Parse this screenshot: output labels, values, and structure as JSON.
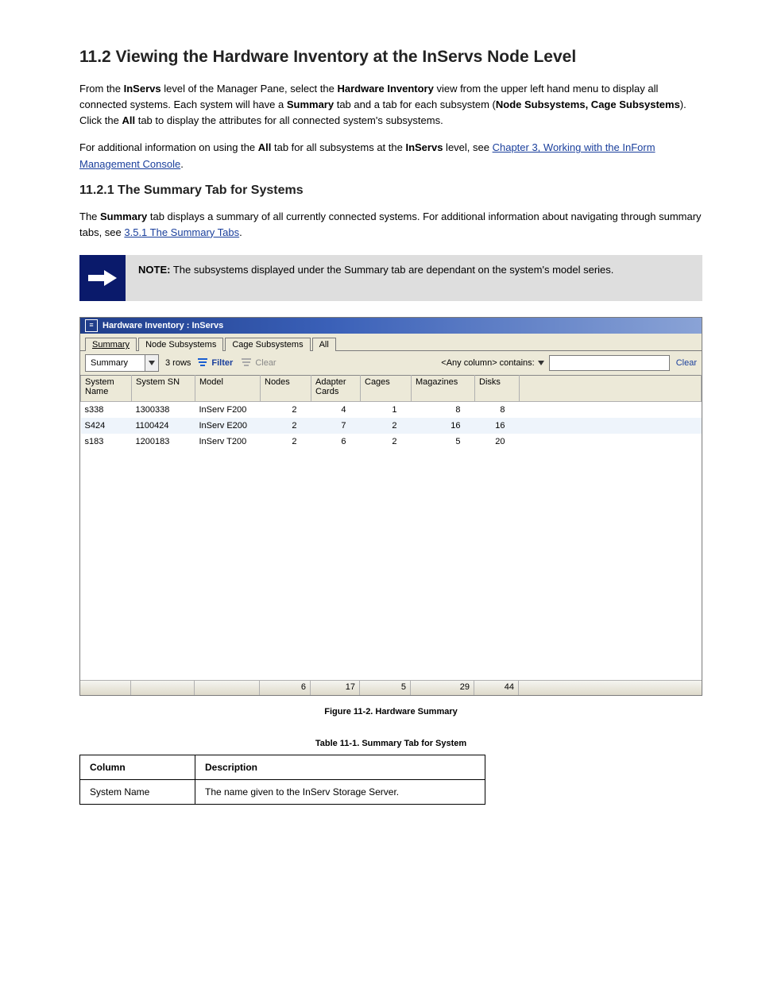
{
  "headings": {
    "page_title": "11.2 Viewing the Hardware Inventory at the InServs Node Level",
    "sub1": "11.2.1 The Summary Tab for Systems",
    "caption": "Figure 11-2.  Hardware Summary",
    "caption2": "Table 11-1.  Summary Tab for System"
  },
  "paragraphs": {
    "p1_a": "From the ",
    "p1_b": " level of the Manager Pane, select the ",
    "p1_c": " view from the upper left hand menu to display all connected systems. Each system will have a ",
    "p1_d": " tab and a tab for each subsystem (",
    "p1_e": "). Click the ",
    "p1_f": " tab to display the attributes for all connected system's subsystems.",
    "p1_inservs": "InServs",
    "p1_hwinv": "Hardware Inventory",
    "p1_summary": "Summary",
    "p1_subs": "Node Subsystems, Cage Subsystems",
    "p1_all": "All",
    "p2_a": "For additional information on using the ",
    "p2_b": " tab for all subsystems at the ",
    "p2_c": " level, see ",
    "p2_link": "Chapter 3, Working with the InForm Management Console",
    "p2_d": ".",
    "p2_all": "All",
    "p2_inservs": "InServs",
    "p3_a": "The ",
    "p3_b": " tab displays a summary of all currently connected systems. For additional information about navigating through summary tabs, see ",
    "p3_link": "3.5.1 The Summary Tabs",
    "p3_c": ".",
    "p3_summary": "Summary"
  },
  "note": {
    "label": "NOTE:",
    "text": " The subsystems displayed under the Summary tab are dependant on the system's model series."
  },
  "window": {
    "title": "Hardware Inventory : InServs",
    "tabs": [
      "Summary",
      "Node Subsystems",
      "Cage Subsystems",
      "All"
    ],
    "combo_value": "Summary",
    "row_count": "3 rows",
    "filter_btn": "Filter",
    "clear_btn": "Clear",
    "filter_label": "<Any column> contains:",
    "clear_link": "Clear",
    "columns": [
      "System Name",
      "System SN",
      "Model",
      "Nodes",
      "Adapter Cards",
      "Cages",
      "Magazines",
      "Disks"
    ],
    "rows": [
      {
        "name": "s338",
        "sn": "1300338",
        "model": "InServ F200",
        "nodes": "2",
        "adapter": "4",
        "cages": "1",
        "mags": "8",
        "disks": "8"
      },
      {
        "name": "S424",
        "sn": "1100424",
        "model": "InServ E200",
        "nodes": "2",
        "adapter": "7",
        "cages": "2",
        "mags": "16",
        "disks": "16"
      },
      {
        "name": "s183",
        "sn": "1200183",
        "model": "InServ T200",
        "nodes": "2",
        "adapter": "6",
        "cages": "2",
        "mags": "5",
        "disks": "20"
      }
    ],
    "totals": {
      "nodes": "6",
      "adapter": "17",
      "cages": "5",
      "mags": "29",
      "disks": "44"
    }
  },
  "def_table": {
    "h1": "Column",
    "h2": "Description",
    "r1c1": "System Name",
    "r1c2": "The name given to the InServ Storage Server."
  }
}
